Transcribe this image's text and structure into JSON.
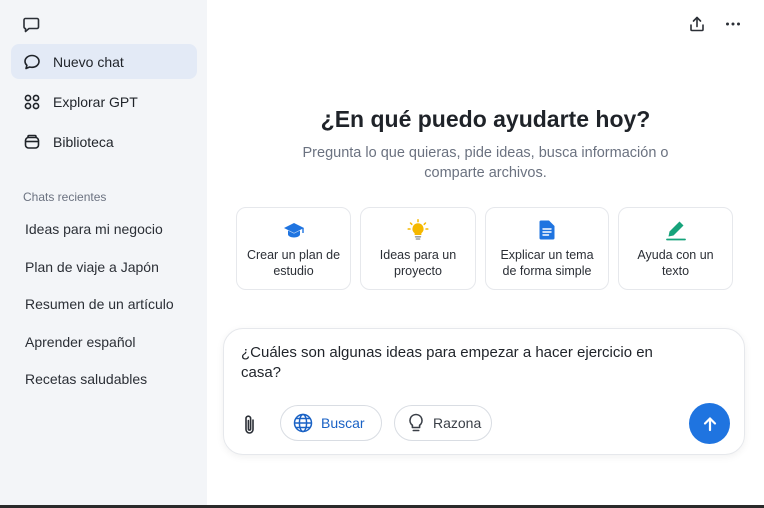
{
  "sidebar": {
    "nav": [
      {
        "label": "Nuevo chat",
        "icon": "chat-bubble-icon",
        "active": true
      },
      {
        "label": "Explorar GPT",
        "icon": "grid-icon",
        "active": false
      },
      {
        "label": "Biblioteca",
        "icon": "library-icon",
        "active": false
      }
    ],
    "recents_title": "Chats recientes",
    "recents": [
      "Ideas para mi negocio",
      "Plan de viaje a Japón",
      "Resumen de un artículo",
      "Aprender español",
      "Recetas saludables"
    ]
  },
  "main": {
    "heading": "¿En qué puedo ayudarte hoy?",
    "subheading": "Pregunta lo que quieras, pide ideas, busca información o comparte archivos.",
    "cards": [
      {
        "label": "Crear un plan de estudio",
        "icon": "graduation-cap-icon",
        "color": "#1f74e0"
      },
      {
        "label": "Ideas para un proyecto",
        "icon": "lightbulb-icon",
        "color": "#f5b800"
      },
      {
        "label": "Explicar un tema de forma simple",
        "icon": "document-icon",
        "color": "#1f74e0"
      },
      {
        "label": "Ayuda con un texto",
        "icon": "pencil-icon",
        "color": "#16a37b"
      }
    ],
    "composer": {
      "text": "¿Cuáles son algunas ideas para empezar a hacer ejercicio en casa?",
      "search_label": "Buscar",
      "reason_label": "Razona"
    }
  },
  "colors": {
    "accent": "#1f74e0",
    "sidebar_bg": "#f3f5f8",
    "active_item": "#e3eaf6"
  }
}
